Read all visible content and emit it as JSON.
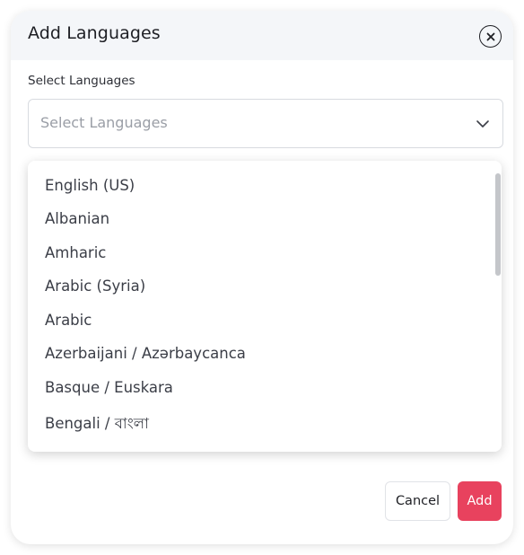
{
  "modal": {
    "title": "Add Languages",
    "close_icon": "close-circle-icon"
  },
  "field": {
    "label": "Select Languages",
    "placeholder": "Select Languages",
    "chevron_icon": "chevron-down-icon"
  },
  "dropdown": {
    "options": [
      "English (US)",
      "Albanian",
      "Amharic",
      "Arabic (Syria)",
      "Arabic",
      "Azerbaijani / Azərbaycanca",
      "Basque / Euskara",
      "Bengali / বাংলা"
    ]
  },
  "footer": {
    "cancel_label": "Cancel",
    "add_label": "Add",
    "accent_color": "#e8425e"
  }
}
